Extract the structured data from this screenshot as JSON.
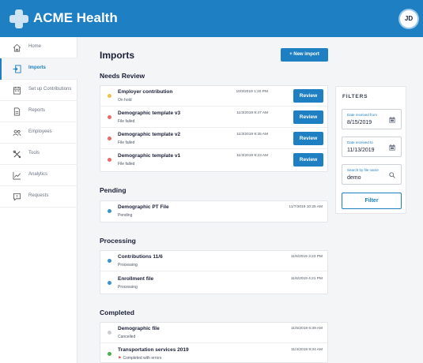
{
  "app": {
    "brand": "ACME Health",
    "user_initials": "JD"
  },
  "colors": {
    "primary": "#1e7fc3",
    "warning": "#f5c04a",
    "error": "#e86a6a",
    "info": "#3a93d0",
    "muted": "#c9cdd3",
    "success": "#4caf50"
  },
  "sidebar": {
    "items": [
      {
        "label": "Home",
        "icon": "home-icon",
        "active": false
      },
      {
        "label": "Imports",
        "icon": "import-icon",
        "active": true
      },
      {
        "label": "Set up Contributions",
        "icon": "calendar-icon",
        "active": false
      },
      {
        "label": "Reports",
        "icon": "report-icon",
        "active": false
      },
      {
        "label": "Employees",
        "icon": "users-icon",
        "active": false
      },
      {
        "label": "Tools",
        "icon": "tools-icon",
        "active": false
      },
      {
        "label": "Analytics",
        "icon": "analytics-icon",
        "active": false
      },
      {
        "label": "Requests",
        "icon": "chat-icon",
        "active": false
      }
    ]
  },
  "main": {
    "title": "Imports",
    "new_import_label": "+ New import",
    "review_label": "Review",
    "sections": {
      "needs_review": {
        "title": "Needs Review",
        "rows": [
          {
            "title": "Employer contribution",
            "status": "On hold",
            "time": "10/3/2019 1:20 PM",
            "color": "#f5c04a"
          },
          {
            "title": "Demographic template v3",
            "status": "File failed",
            "time": "11/3/2019 9:47 AM",
            "color": "#e86a6a"
          },
          {
            "title": "Demographic template v2",
            "status": "File failed",
            "time": "11/3/2019 9:35 AM",
            "color": "#e86a6a"
          },
          {
            "title": "Demographic template v1",
            "status": "File failed",
            "time": "11/3/2019 9:23 AM",
            "color": "#e86a6a"
          }
        ]
      },
      "pending": {
        "title": "Pending",
        "rows": [
          {
            "title": "Demographic PT File",
            "status": "Pending",
            "time": "11/7/2019 10:25 AM",
            "color": "#3a93d0"
          }
        ]
      },
      "processing": {
        "title": "Processing",
        "rows": [
          {
            "title": "Contributions 11/6",
            "status": "Processing",
            "time": "11/6/2019 3:23 PM",
            "color": "#3a93d0"
          },
          {
            "title": "Enrollment file",
            "status": "Processing",
            "time": "11/6/2019 4:21 PM",
            "color": "#3a93d0"
          }
        ]
      },
      "completed": {
        "title": "Completed",
        "rows": [
          {
            "title": "Demographic file",
            "status": "Cancelled",
            "time": "11/5/2019 6:39 AM",
            "color": "#c9cdd3"
          },
          {
            "title": "Transportation services 2019",
            "status": "Completed with errors",
            "time": "11/4/2019 9:34 AM",
            "color": "#4caf50"
          }
        ]
      }
    }
  },
  "filters": {
    "title": "FILTERS",
    "date_from": {
      "label": "Date received from",
      "value": "8/15/2019"
    },
    "date_to": {
      "label": "Date received to",
      "value": "11/13/2019"
    },
    "search": {
      "label": "Search by file name",
      "value": "demo"
    },
    "button_label": "Filter"
  }
}
